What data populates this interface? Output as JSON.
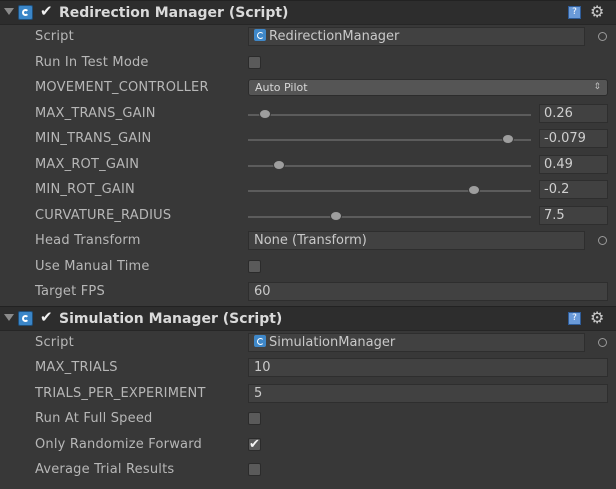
{
  "components": [
    {
      "title": "Redirection Manager (Script)",
      "script": "RedirectionManager",
      "labels": {
        "script": "Script",
        "run_in_test_mode": "Run In Test Mode",
        "movement_controller": "MOVEMENT_CONTROLLER",
        "max_trans_gain": "MAX_TRANS_GAIN",
        "min_trans_gain": "MIN_TRANS_GAIN",
        "max_rot_gain": "MAX_ROT_GAIN",
        "min_rot_gain": "MIN_ROT_GAIN",
        "curvature_radius": "CURVATURE_RADIUS",
        "head_transform": "Head Transform",
        "use_manual_time": "Use Manual Time",
        "target_fps": "Target FPS"
      },
      "values": {
        "run_in_test_mode": false,
        "movement_controller": "Auto Pilot",
        "max_trans_gain": "0.26",
        "min_trans_gain": "-0.079",
        "max_rot_gain": "0.49",
        "min_rot_gain": "-0.2",
        "curvature_radius": "7.5",
        "head_transform": "None (Transform)",
        "use_manual_time": false,
        "target_fps": "60"
      },
      "slider_fractions": {
        "max_trans_gain": 0.06,
        "min_trans_gain": 0.92,
        "max_rot_gain": 0.11,
        "min_rot_gain": 0.8,
        "curvature_radius": 0.31
      }
    },
    {
      "title": "Simulation Manager (Script)",
      "script": "SimulationManager",
      "labels": {
        "script": "Script",
        "max_trials": "MAX_TRIALS",
        "trials_per_experiment": "TRIALS_PER_EXPERIMENT",
        "run_at_full_speed": "Run At Full Speed",
        "only_randomize_forward": "Only Randomize Forward",
        "average_trial_results": "Average Trial Results"
      },
      "values": {
        "max_trials": "10",
        "trials_per_experiment": "5",
        "run_at_full_speed": false,
        "only_randomize_forward": true,
        "average_trial_results": false
      }
    }
  ],
  "icons": {
    "foldout": "foldout-arrow-icon",
    "component": "csharp-script-icon",
    "help": "help-book-icon",
    "settings": "gear-icon",
    "picker": "object-picker-icon"
  },
  "colors": {
    "background": "#383838",
    "header": "#2d2d2d",
    "field": "#414141",
    "accent": "#3b86c8"
  }
}
